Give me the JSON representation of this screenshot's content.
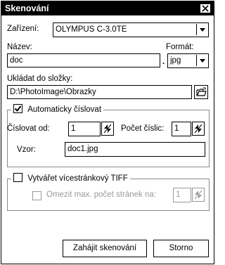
{
  "window": {
    "title": "Skenování",
    "close_icon": "close-icon"
  },
  "device": {
    "label": "Zařízení:",
    "value": "OLYMPUS C-3.0TE"
  },
  "name": {
    "label": "Název:",
    "value": "doc",
    "separator": "."
  },
  "format": {
    "label": "Formát:",
    "value": "jpg"
  },
  "save_folder": {
    "label": "Ukládat do složky:",
    "value": "D:\\PhotoImage\\Obrazky",
    "browse_icon": "folder-open-icon"
  },
  "auto_number": {
    "checkbox_label": "Automaticky číslovat",
    "checked": true,
    "start_label": "Číslovat od:",
    "start_value": "1",
    "digits_label": "Počet číslic:",
    "digits_value": "1",
    "pattern_label": "Vzor:",
    "pattern_value": "doc1.jpg"
  },
  "multipage": {
    "checkbox_label": "Vytvářet vícestránkový TIFF",
    "checked": false,
    "limit_label": "Omezit max. počet stránek na:",
    "limit_checked": false,
    "limit_value": "1"
  },
  "buttons": {
    "start": "Zahájit skenování",
    "cancel": "Storno"
  }
}
